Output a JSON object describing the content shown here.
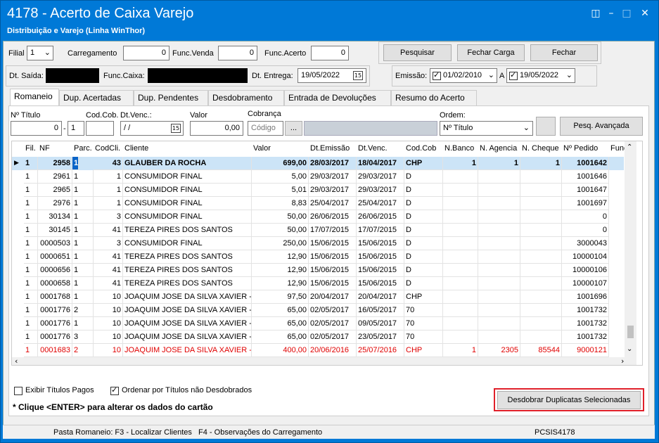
{
  "window": {
    "title": "4178 - Acerto de Caixa Varejo",
    "subtitle": "Distribuição e Varejo (Linha WinThor)"
  },
  "filters": {
    "filial_label": "Filial",
    "filial_value": "1",
    "carregamento_label": "Carregamento",
    "carregamento_value": "0",
    "func_venda_label": "Func.Venda",
    "func_venda_value": "0",
    "func_acerto_label": "Func.Acerto",
    "func_acerto_value": "0",
    "dt_saida_label": "Dt. Saída:",
    "func_caixa_label": "Func.Caixa:",
    "dt_entrega_label": "Dt. Entrega:",
    "dt_entrega_value": "19/05/2022",
    "emissao_label": "Emissão:",
    "emissao_from": "01/02/2010",
    "emissao_to_label": "A",
    "emissao_to": "19/05/2022"
  },
  "toolbar": {
    "pesquisar_label": "Pesquisar",
    "fechar_carga_label": "Fechar Carga",
    "fechar_label": "Fechar"
  },
  "tabs": [
    "Romaneio",
    "Dup. Acertadas",
    "Dup. Pendentes",
    "Desdobramento",
    "Entrada de Devoluções",
    "Resumo do Acerto"
  ],
  "search": {
    "titulo_label": "Nº Título",
    "titulo_value": "0",
    "titulo_parc": "1",
    "codcob_label": "Cod.Cob.",
    "dtvenc_label": "Dt.Venc.:",
    "dtvenc_value": " / /",
    "valor_label": "Valor",
    "valor_value": "0,00",
    "cobranca_label": "Cobrança",
    "cobranca_placeholder": "Código",
    "cobranca_btn": "...",
    "ordem_label": "Ordem:",
    "ordem_value": "Nº Título",
    "pesq_avancada_label": "Pesq. Avançada"
  },
  "grid": {
    "columns": [
      "Fil.",
      "NF",
      "Parc.",
      "CodCli.",
      "Cliente",
      "Valor",
      "Dt.Emissão",
      "Dt.Venc.",
      "Cod.Cob",
      "N.Banco",
      "N. Agencia",
      "N. Cheque",
      "Nº Pedido",
      "Func"
    ],
    "rows": [
      [
        "1",
        "2958",
        "1",
        "43",
        "GLAUBER DA ROCHA",
        "699,00",
        "28/03/2017",
        "18/04/2017",
        "CHP",
        "1",
        "1",
        "1",
        "1001642"
      ],
      [
        "1",
        "2961",
        "1",
        "1",
        "CONSUMIDOR FINAL",
        "5,00",
        "29/03/2017",
        "29/03/2017",
        "D",
        "",
        "",
        "",
        "1001646"
      ],
      [
        "1",
        "2965",
        "1",
        "1",
        "CONSUMIDOR FINAL",
        "5,01",
        "29/03/2017",
        "29/03/2017",
        "D",
        "",
        "",
        "",
        "1001647"
      ],
      [
        "1",
        "2976",
        "1",
        "1",
        "CONSUMIDOR FINAL",
        "8,83",
        "25/04/2017",
        "25/04/2017",
        "D",
        "",
        "",
        "",
        "1001697"
      ],
      [
        "1",
        "30134",
        "1",
        "3",
        "CONSUMIDOR FINAL",
        "50,00",
        "26/06/2015",
        "26/06/2015",
        "D",
        "",
        "",
        "",
        "0"
      ],
      [
        "1",
        "30145",
        "1",
        "41",
        "TEREZA PIRES DOS SANTOS",
        "50,00",
        "17/07/2015",
        "17/07/2015",
        "D",
        "",
        "",
        "",
        "0"
      ],
      [
        "1",
        "0000503",
        "1",
        "3",
        "CONSUMIDOR FINAL",
        "250,00",
        "15/06/2015",
        "15/06/2015",
        "D",
        "",
        "",
        "",
        "3000043"
      ],
      [
        "1",
        "0000651",
        "1",
        "41",
        "TEREZA PIRES DOS SANTOS",
        "12,90",
        "15/06/2015",
        "15/06/2015",
        "D",
        "",
        "",
        "",
        "10000104"
      ],
      [
        "1",
        "0000656",
        "1",
        "41",
        "TEREZA PIRES DOS SANTOS",
        "12,90",
        "15/06/2015",
        "15/06/2015",
        "D",
        "",
        "",
        "",
        "10000106"
      ],
      [
        "1",
        "0000658",
        "1",
        "41",
        "TEREZA PIRES DOS SANTOS",
        "12,90",
        "15/06/2015",
        "15/06/2015",
        "D",
        "",
        "",
        "",
        "10000107"
      ],
      [
        "1",
        "0001768",
        "1",
        "10",
        "JOAQUIM JOSE DA SILVA XAVIER -",
        "97,50",
        "20/04/2017",
        "20/04/2017",
        "CHP",
        "",
        "",
        "",
        "1001696"
      ],
      [
        "1",
        "0001776",
        "2",
        "10",
        "JOAQUIM JOSE DA SILVA XAVIER -",
        "65,00",
        "02/05/2017",
        "16/05/2017",
        "70",
        "",
        "",
        "",
        "1001732"
      ],
      [
        "1",
        "0001776",
        "1",
        "10",
        "JOAQUIM JOSE DA SILVA XAVIER -",
        "65,00",
        "02/05/2017",
        "09/05/2017",
        "70",
        "",
        "",
        "",
        "1001732"
      ],
      [
        "1",
        "0001776",
        "3",
        "10",
        "JOAQUIM JOSE DA SILVA XAVIER -",
        "65,00",
        "02/05/2017",
        "23/05/2017",
        "70",
        "",
        "",
        "",
        "1001732"
      ],
      [
        "1",
        "0001683",
        "2",
        "10",
        "JOAQUIM JOSE DA SILVA XAVIER -",
        "400,00",
        "20/06/2016",
        "25/07/2016",
        "CHP",
        "1",
        "2305",
        "85544",
        "9000121"
      ]
    ]
  },
  "options": {
    "exibir_pagos_label": "Exibir Títulos Pagos",
    "ordenar_label": "Ordenar por Títulos não Desdobrados",
    "hint": "* Clique <ENTER> para alterar os dados do cartão",
    "desdobrar_label": "Desdobrar Duplicatas Selecionadas"
  },
  "statusbar": {
    "text": "Pasta Romaneio: F3 - Localizar Clientes   F4 - Observações do Carregamento",
    "code": "PCSIS4178"
  },
  "colors": {
    "titlebar": "#0079d7",
    "selected_row": "#cce4f7",
    "red_row": "#e00000",
    "highlight_border": "#e0202a"
  }
}
